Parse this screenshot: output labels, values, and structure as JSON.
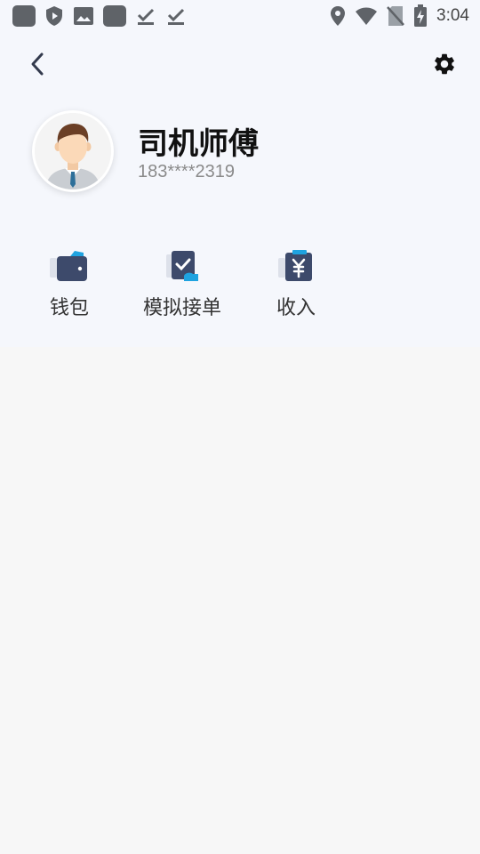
{
  "status_bar": {
    "time": "3:04",
    "left_icons": [
      "app-icon",
      "shield-play-icon",
      "image-icon",
      "app-icon",
      "download-done-icon",
      "download-done-icon"
    ],
    "right_icons": [
      "location-icon",
      "wifi-icon",
      "no-sim-icon",
      "battery-charging-icon"
    ]
  },
  "nav": {
    "back_icon": "chevron-left-icon",
    "settings_icon": "gear-icon"
  },
  "profile": {
    "name": "司机师傅",
    "phone": "183****2319"
  },
  "menu": [
    {
      "label": "钱包",
      "icon": "wallet-icon"
    },
    {
      "label": "模拟接单",
      "icon": "simulate-order-icon"
    },
    {
      "label": "收入",
      "icon": "income-icon"
    }
  ],
  "colors": {
    "header_bg": "#f5f7fc",
    "page_bg": "#f7f7f7",
    "icon_navy": "#3d4a6b",
    "icon_accent": "#1fa3e0"
  }
}
